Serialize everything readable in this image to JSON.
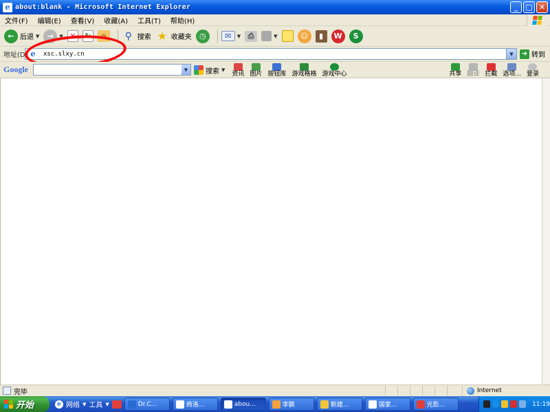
{
  "window": {
    "title": "about:blank - Microsoft Internet Explorer"
  },
  "menu": {
    "items": [
      "文件(F)",
      "编辑(E)",
      "查看(V)",
      "收藏(A)",
      "工具(T)",
      "帮助(H)"
    ]
  },
  "toolbar": {
    "back_label": "后退",
    "search_label": "搜索",
    "favorites_label": "收藏夹"
  },
  "address": {
    "label": "地址(D)",
    "value": "xsc.slxy.cn",
    "go_label": "转到"
  },
  "google": {
    "logo": "Google",
    "search_label": "搜索",
    "items": [
      "资讯",
      "图片",
      "按钮库",
      "游戏格格",
      "游戏中心"
    ],
    "right_items": [
      "共享",
      "翻译",
      "拦截",
      "选项...",
      "登录"
    ]
  },
  "status": {
    "text": "完毕",
    "zone": "Internet"
  },
  "taskbar": {
    "start_label": "开始",
    "quick_items": [
      "网络",
      "工具"
    ],
    "tasks": [
      "Dr.C...",
      "商洛...",
      "abou...",
      "李鹏",
      "新建...",
      "国家...",
      "光影..."
    ],
    "active_task_index": 2,
    "clock": "11:19"
  },
  "colors": {
    "titlebar": "#0a5fe0",
    "chrome": "#ece9d8",
    "annotation_circle": "#f20d0d",
    "taskbar": "#2457c9",
    "start": "#3c9a3c"
  }
}
